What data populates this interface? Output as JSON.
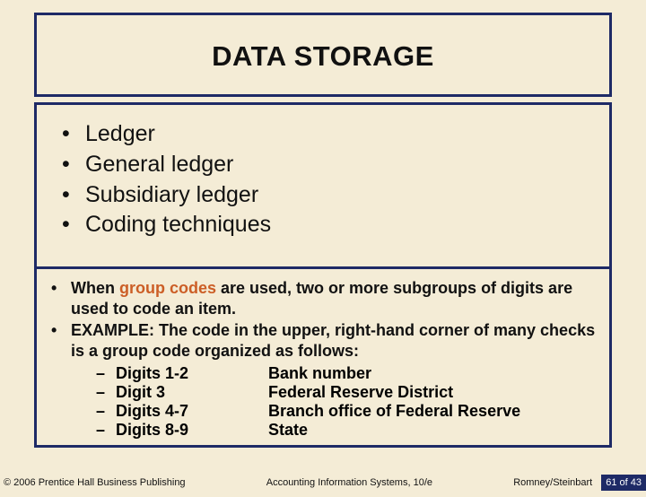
{
  "title": "DATA STORAGE",
  "bullets": [
    "Ledger",
    "General ledger",
    "Subsidiary ledger",
    "Coding techniques"
  ],
  "detail": {
    "item1": {
      "prefix": "When ",
      "highlight": "group codes",
      "suffix": " are used, two or more subgroups of digits are used to code an item."
    },
    "item2": "EXAMPLE:  The code in the upper, right-hand corner of many checks is a group code organized as follows:",
    "rows": [
      {
        "k": "Digits 1-2",
        "v": "Bank number"
      },
      {
        "k": "Digit 3",
        "v": "Federal Reserve District"
      },
      {
        "k": "Digits 4-7",
        "v": "Branch office of Federal Reserve"
      },
      {
        "k": "Digits 8-9",
        "v": "State"
      }
    ]
  },
  "footer": {
    "left": "© 2006 Prentice Hall Business Publishing",
    "center": "Accounting Information Systems, 10/e",
    "right": "Romney/Steinbart",
    "page": "61 of 43"
  }
}
